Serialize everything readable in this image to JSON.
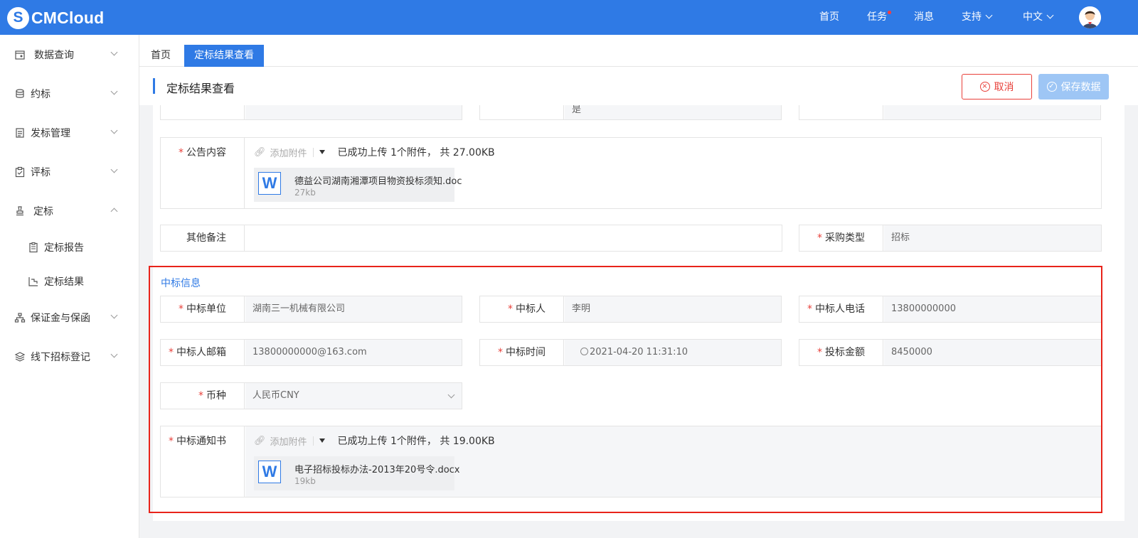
{
  "brand": {
    "logo_letter": "S",
    "name": "CMCloud"
  },
  "topnav": {
    "home": "首页",
    "tasks": "任务",
    "messages": "消息",
    "support": "支持",
    "language": "中文"
  },
  "sidebar": {
    "items": [
      {
        "label": "数据查询",
        "icon": "data-query-icon",
        "expanded": false
      },
      {
        "label": "约标",
        "icon": "coins-icon",
        "expanded": false
      },
      {
        "label": "发标管理",
        "icon": "document-icon",
        "expanded": false
      },
      {
        "label": "评标",
        "icon": "clipboard-check-icon",
        "expanded": false
      },
      {
        "label": "定标",
        "icon": "stamp-icon",
        "expanded": true
      },
      {
        "label": "保证金与保函",
        "icon": "org-chart-icon",
        "expanded": false
      },
      {
        "label": "线下招标登记",
        "icon": "layers-icon",
        "expanded": false
      }
    ],
    "sub_items": [
      {
        "label": "定标报告",
        "icon": "report-icon"
      },
      {
        "label": "定标结果",
        "icon": "result-icon"
      }
    ]
  },
  "tabs": [
    {
      "label": "首页",
      "active": false
    },
    {
      "label": "定标结果查看",
      "active": true
    }
  ],
  "page": {
    "title": "定标结果查看",
    "cancel_label": "取消",
    "save_label": "保存数据"
  },
  "partial_fields": {
    "col2_value": "是"
  },
  "announcement": {
    "label": "公告内容",
    "add_attachment": "添加附件",
    "upload_status": "已成功上传 1个附件， 共 27.00KB",
    "file_name": "德益公司湖南湘潭项目物资投标须知.doc",
    "file_size": "27kb"
  },
  "other_notes": {
    "label": "其他备注",
    "value": ""
  },
  "purchase_type": {
    "label": "采购类型",
    "value": "招标"
  },
  "winning_info": {
    "section_title": "中标信息",
    "unit": {
      "label": "中标单位",
      "value": "湖南三一机械有限公司"
    },
    "person": {
      "label": "中标人",
      "value": "李明"
    },
    "phone": {
      "label": "中标人电话",
      "value": "13800000000"
    },
    "email": {
      "label": "中标人邮箱",
      "value": "13800000000@163.com"
    },
    "time": {
      "label": "中标时间",
      "value": "2021-04-20 11:31:10"
    },
    "amount": {
      "label": "投标金额",
      "value": "8450000"
    },
    "currency": {
      "label": "币种",
      "value": "人民币CNY"
    },
    "notice": {
      "label": "中标通知书",
      "add_attachment": "添加附件",
      "upload_status": "已成功上传 1个附件， 共 19.00KB",
      "file_name": "电子招标投标办法-2013年20号令.docx",
      "file_size": "19kb"
    }
  },
  "colors": {
    "primary": "#2f7ae5",
    "danger": "#e8403a",
    "highlight": "#e8231a",
    "save_disabled": "#9ec6f5"
  }
}
